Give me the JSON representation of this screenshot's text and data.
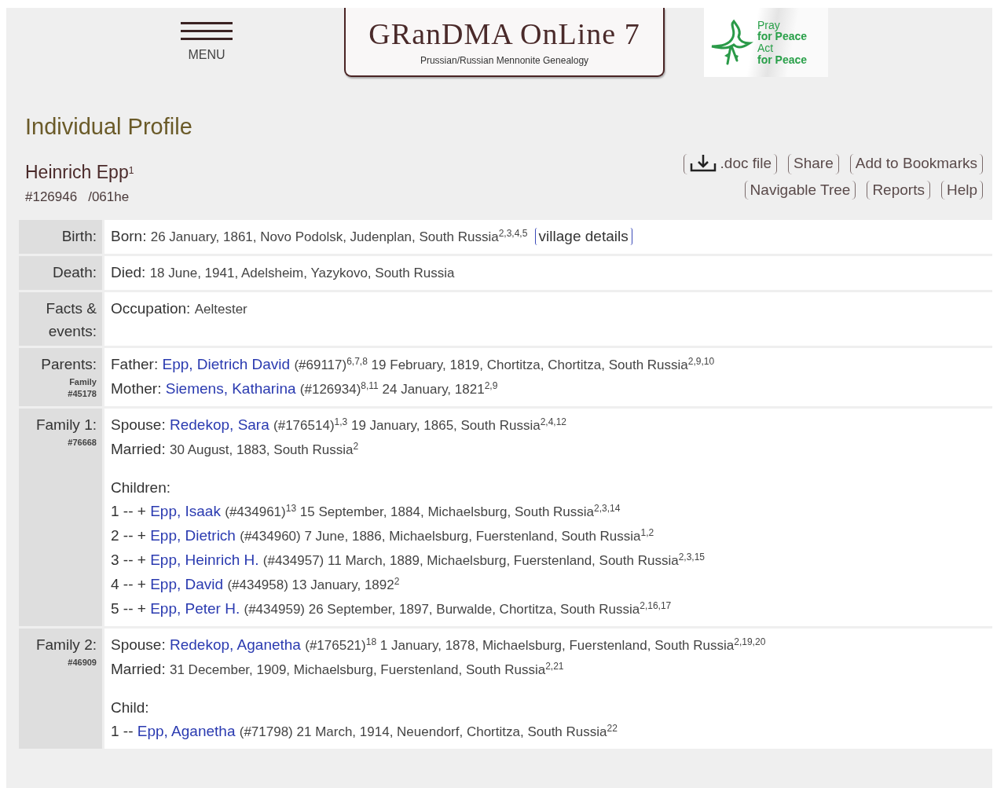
{
  "header": {
    "menu_label": "MENU",
    "logo_title": "GRanDMA OnLine 7",
    "logo_subtitle": "Prussian/Russian Mennonite Genealogy",
    "banner_lines": [
      {
        "text": "Pray",
        "bold": false
      },
      {
        "text": "for Peace",
        "bold": true
      },
      {
        "text": "Act",
        "bold": false
      },
      {
        "text": "for Peace",
        "bold": true
      }
    ]
  },
  "page_title": "Individual Profile",
  "person": {
    "name": "Heinrich Epp",
    "note": "1",
    "id": "#126946",
    "code": "/061he"
  },
  "actions": [
    [
      {
        "kind": "download",
        "label": ".doc file"
      },
      {
        "kind": "plain",
        "label": "Share"
      },
      {
        "kind": "plain",
        "label": "Add to Bookmarks"
      }
    ],
    [
      {
        "kind": "plain",
        "label": "Navigable Tree"
      },
      {
        "kind": "plain",
        "label": "Reports"
      },
      {
        "kind": "plain",
        "label": "Help"
      }
    ]
  ],
  "sections": [
    {
      "label": "Birth:",
      "lines": [
        [
          {
            "kind": "label",
            "text": "Born:"
          },
          {
            "kind": "text",
            "text": "26 January, 1861, Novo Podolsk, Judenplan, South Russia$^{2,3,4,5}$"
          },
          {
            "kind": "button",
            "text": "village details"
          }
        ]
      ]
    },
    {
      "label": "Death:",
      "lines": [
        [
          {
            "kind": "label",
            "text": "Died:"
          },
          {
            "kind": "text",
            "text": "18 June, 1941, Adelsheim, Yazykovo, South Russia"
          }
        ]
      ]
    },
    {
      "label": "Facts & events:",
      "lines": [
        [
          {
            "kind": "label",
            "text": "Occupation:"
          },
          {
            "kind": "text",
            "text": "Aeltester"
          }
        ]
      ]
    },
    {
      "label": "Parents:",
      "sublabel": [
        "Family",
        "#45178"
      ],
      "lines": [
        [
          {
            "kind": "label",
            "text": "Father:"
          },
          {
            "kind": "link",
            "text": "Epp, Dietrich David"
          },
          {
            "kind": "text",
            "text": "(#69117)$^{6,7,8}$ 19 February, 1819, Chortitza, Chortitza, South Russia$^{2,9,10}$"
          }
        ],
        [
          {
            "kind": "label",
            "text": "Mother:"
          },
          {
            "kind": "link",
            "text": "Siemens, Katharina"
          },
          {
            "kind": "text",
            "text": "(#126934)$^{8,11}$ 24 January, 1821$^{2,9}$"
          }
        ]
      ]
    },
    {
      "label": "Family 1:",
      "sublabel": [
        "#76668"
      ],
      "lines": [
        [
          {
            "kind": "label",
            "text": "Spouse:"
          },
          {
            "kind": "link",
            "text": "Redekop, Sara"
          },
          {
            "kind": "text",
            "text": "(#176514)$^{1,3}$ 19 January, 1865, South Russia$^{2,4,12}$"
          }
        ],
        [
          {
            "kind": "label",
            "text": "Married:"
          },
          {
            "kind": "text",
            "text": "30 August, 1883, South Russia$^{2}$"
          }
        ]
      ],
      "children_title": "Children:",
      "children": [
        [
          {
            "kind": "label",
            "text": "1 -- +"
          },
          {
            "kind": "link",
            "text": "Epp, Isaak"
          },
          {
            "kind": "text",
            "text": "(#434961)$^{13}$ 15 September, 1884, Michaelsburg, South Russia$^{2,3,14}$"
          }
        ],
        [
          {
            "kind": "label",
            "text": "2 -- +"
          },
          {
            "kind": "link",
            "text": "Epp, Dietrich"
          },
          {
            "kind": "text",
            "text": "(#434960) 7 June, 1886, Michaelsburg, Fuerstenland, South Russia$^{1,2}$"
          }
        ],
        [
          {
            "kind": "label",
            "text": "3 -- +"
          },
          {
            "kind": "link",
            "text": "Epp, Heinrich H."
          },
          {
            "kind": "text",
            "text": "(#434957) 11 March, 1889, Michaelsburg, Fuerstenland, South Russia$^{2,3,15}$"
          }
        ],
        [
          {
            "kind": "label",
            "text": "4 -- +"
          },
          {
            "kind": "link",
            "text": "Epp, David"
          },
          {
            "kind": "text",
            "text": "(#434958) 13 January, 1892$^{2}$"
          }
        ],
        [
          {
            "kind": "label",
            "text": "5 -- +"
          },
          {
            "kind": "link",
            "text": "Epp, Peter H."
          },
          {
            "kind": "text",
            "text": "(#434959) 26 September, 1897, Burwalde, Chortitza, South Russia$^{2,16,17}$"
          }
        ]
      ]
    },
    {
      "label": "Family 2:",
      "sublabel": [
        "#46909"
      ],
      "lines": [
        [
          {
            "kind": "label",
            "text": "Spouse:"
          },
          {
            "kind": "link",
            "text": "Redekop, Aganetha"
          },
          {
            "kind": "text",
            "text": "(#176521)$^{18}$ 1 January, 1878, Michaelsburg, Fuerstenland, South Russia$^{2,19,20}$"
          }
        ],
        [
          {
            "kind": "label",
            "text": "Married:"
          },
          {
            "kind": "text",
            "text": "31 December, 1909, Michaelsburg, Fuerstenland, South Russia$^{2,21}$"
          }
        ]
      ],
      "children_title": "Child:",
      "children": [
        [
          {
            "kind": "label",
            "text": "1 --"
          },
          {
            "kind": "link",
            "text": "Epp, Aganetha"
          },
          {
            "kind": "text",
            "text": "(#71798) 21 March, 1914, Neuendorf, Chortitza, South Russia$^{22}$"
          }
        ]
      ]
    }
  ]
}
